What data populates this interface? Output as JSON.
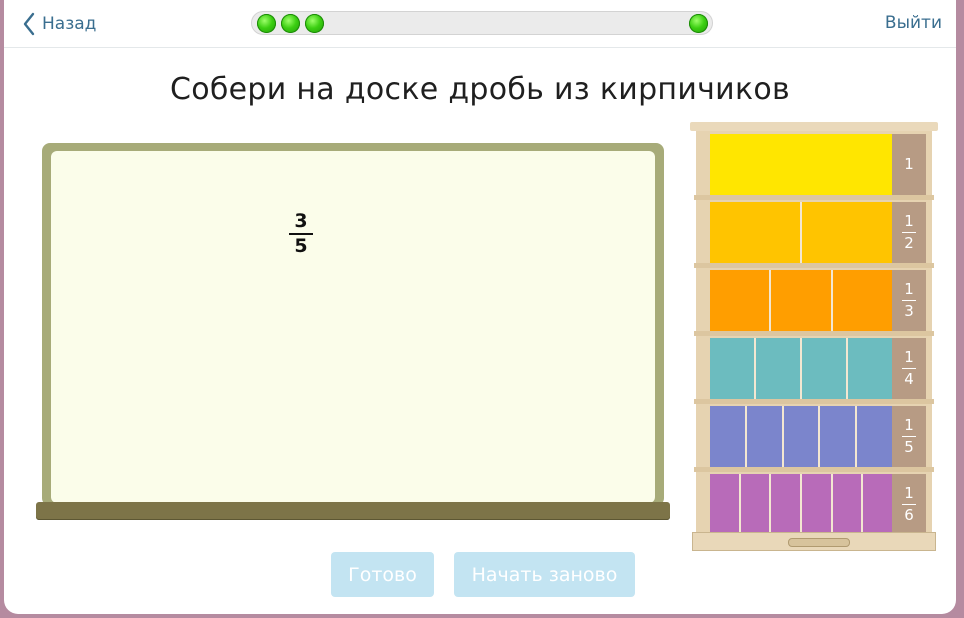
{
  "header": {
    "back_label": "Назад",
    "exit_label": "Выйти",
    "progress": {
      "completed": 3,
      "total": 4
    }
  },
  "task": {
    "title": "Собери на доске дробь из кирпичиков",
    "target_fraction": {
      "numerator": "3",
      "denominator": "5"
    }
  },
  "shelf": {
    "rows": [
      {
        "bricks": 1,
        "color": "#ffe600",
        "label_num": "1",
        "label_den": ""
      },
      {
        "bricks": 2,
        "color": "#ffc400",
        "label_num": "1",
        "label_den": "2"
      },
      {
        "bricks": 3,
        "color": "#ff9e00",
        "label_num": "1",
        "label_den": "3"
      },
      {
        "bricks": 4,
        "color": "#6cbcbf",
        "label_num": "1",
        "label_den": "4"
      },
      {
        "bricks": 5,
        "color": "#7b85cc",
        "label_num": "1",
        "label_den": "5"
      },
      {
        "bricks": 6,
        "color": "#b86bb9",
        "label_num": "1",
        "label_den": "6"
      }
    ]
  },
  "buttons": {
    "done_label": "Готово",
    "restart_label": "Начать заново"
  }
}
